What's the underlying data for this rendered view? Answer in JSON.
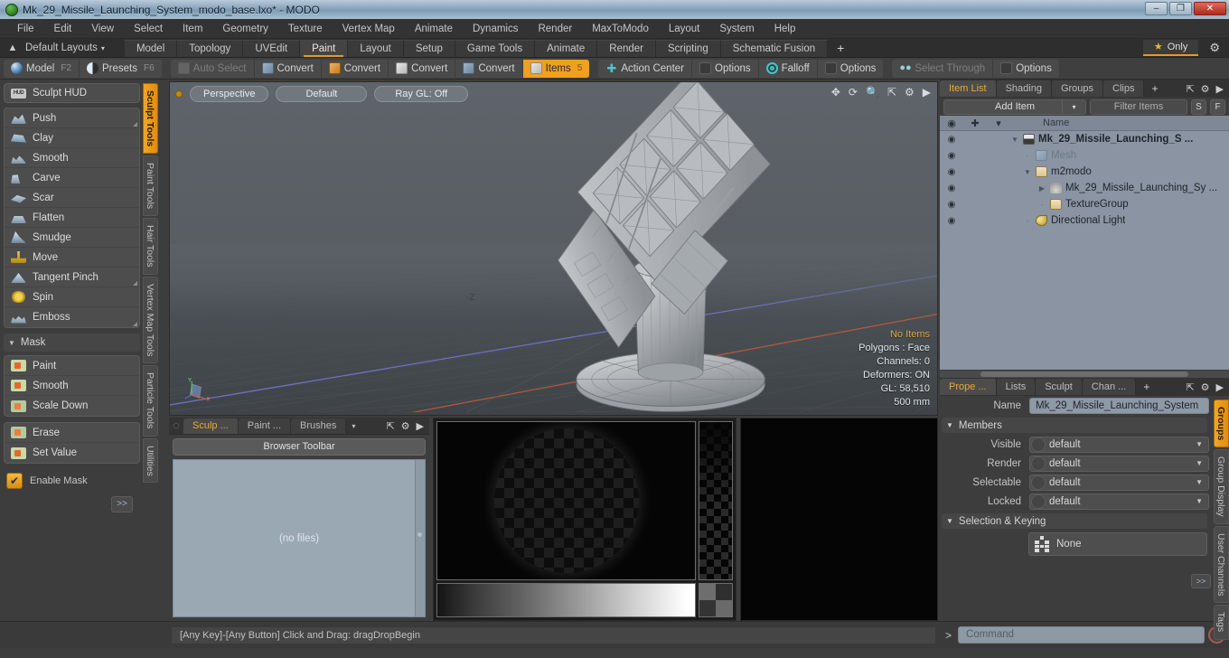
{
  "window": {
    "title": "Mk_29_Missile_Launching_System_modo_base.lxo* - MODO",
    "app_icon": "modo-logo-icon",
    "minimize": "–",
    "maximize": "❐",
    "close": "✕"
  },
  "menubar": {
    "items": [
      "File",
      "Edit",
      "View",
      "Select",
      "Item",
      "Geometry",
      "Texture",
      "Vertex Map",
      "Animate",
      "Dynamics",
      "Render",
      "MaxToModo",
      "Layout",
      "System",
      "Help"
    ]
  },
  "layoutbar": {
    "home_icon": "home-icon",
    "layouts_label": "Default Layouts",
    "caret": "▾",
    "tabs": [
      {
        "label": "Model",
        "active": false
      },
      {
        "label": "Topology",
        "active": false
      },
      {
        "label": "UVEdit",
        "active": false
      },
      {
        "label": "Paint",
        "active": true
      },
      {
        "label": "Layout",
        "active": false
      },
      {
        "label": "Setup",
        "active": false
      },
      {
        "label": "Game Tools",
        "active": false
      },
      {
        "label": "Animate",
        "active": false
      },
      {
        "label": "Render",
        "active": false
      },
      {
        "label": "Scripting",
        "active": false
      },
      {
        "label": "Schematic Fusion",
        "active": false
      }
    ],
    "add_tab": "+",
    "only_label": "Only",
    "star": "★",
    "gear": "⚙"
  },
  "toolbar": {
    "mode_group": [
      {
        "label": "Model",
        "fkey": "F2",
        "icon": "sphere-icon"
      },
      {
        "label": "Presets",
        "fkey": "F6",
        "icon": "half-sphere-icon"
      }
    ],
    "convert_group": [
      {
        "label": "Auto Select",
        "icon": "cube-dim-icon",
        "dim": true
      },
      {
        "label": "Convert",
        "icon": "cube-blue-icon",
        "dim": false
      },
      {
        "label": "Convert",
        "icon": "cube-orange-icon",
        "dim": false
      },
      {
        "label": "Convert",
        "icon": "cube-white-icon",
        "dim": false
      },
      {
        "label": "Convert",
        "icon": "cube-grey-icon",
        "dim": false
      },
      {
        "label": "Items",
        "icon": "cube-items-icon",
        "dim": false,
        "highlight": true,
        "badge": "5"
      }
    ],
    "action_group": [
      {
        "label": "Action Center",
        "icon": "crosshair-icon"
      },
      {
        "label": "Options",
        "icon": "checkbox-icon"
      },
      {
        "label": "Falloff",
        "icon": "target-icon"
      },
      {
        "label": "Options",
        "icon": "checkbox-icon"
      }
    ],
    "select_group": [
      {
        "label": "Select Through",
        "icon": "people-icon",
        "dim": true
      },
      {
        "label": "Options",
        "icon": "checkbox-icon",
        "dim": false
      }
    ]
  },
  "left_panel": {
    "hud": {
      "label": "Sculpt HUD",
      "icon": "hud-icon"
    },
    "sculpt_tools": [
      {
        "label": "Push",
        "icon": "push-icon",
        "corner": true
      },
      {
        "label": "Clay",
        "icon": "clay-icon",
        "corner": false
      },
      {
        "label": "Smooth",
        "icon": "smooth-icon",
        "corner": false
      },
      {
        "label": "Carve",
        "icon": "carve-icon",
        "corner": false
      },
      {
        "label": "Scar",
        "icon": "scar-icon",
        "corner": false
      },
      {
        "label": "Flatten",
        "icon": "flatten-icon",
        "corner": false
      },
      {
        "label": "Smudge",
        "icon": "smudge-icon",
        "corner": false
      },
      {
        "label": "Move",
        "icon": "move-icon",
        "corner": false
      },
      {
        "label": "Tangent Pinch",
        "icon": "pinch-icon",
        "corner": true
      },
      {
        "label": "Spin",
        "icon": "spin-icon",
        "corner": false
      },
      {
        "label": "Emboss",
        "icon": "emboss-icon",
        "corner": true
      }
    ],
    "mask_section": {
      "label": "Mask",
      "triangle": "▼"
    },
    "mask_tools_a": [
      {
        "label": "Paint",
        "icon": "mask-paint-icon"
      },
      {
        "label": "Smooth",
        "icon": "mask-smooth-icon"
      },
      {
        "label": "Scale Down",
        "icon": "mask-scale-icon"
      }
    ],
    "mask_tools_b": [
      {
        "label": "Erase",
        "icon": "mask-erase-icon"
      },
      {
        "label": "Set Value",
        "icon": "mask-setvalue-icon"
      }
    ],
    "enable_mask": {
      "label": "Enable Mask",
      "checked": true,
      "check": "✔"
    },
    "expand_btn": ">>",
    "vtabs": [
      {
        "label": "Sculpt Tools",
        "active": true
      },
      {
        "label": "Paint Tools",
        "active": false
      },
      {
        "label": "Hair Tools",
        "active": false
      },
      {
        "label": "Vertex Map Tools",
        "active": false
      },
      {
        "label": "Particle Tools",
        "active": false
      },
      {
        "label": "Utilities",
        "active": false
      }
    ]
  },
  "viewport": {
    "pills": [
      "Perspective",
      "Default",
      "Ray GL: Off"
    ],
    "tool_icons": [
      "move-icon",
      "rotate-icon",
      "zoom-icon",
      "fit-icon",
      "gear-icon",
      "play-icon"
    ],
    "axis_label": "-Z",
    "stats": {
      "no_items": "No Items",
      "polygons": "Polygons : Face",
      "channels": "Channels: 0",
      "deformers": "Deformers: ON",
      "gl": "GL: 58,510",
      "scale": "500 mm"
    }
  },
  "browser_panel": {
    "tabs": [
      {
        "label": "Sculp ...",
        "active": true
      },
      {
        "label": "Paint ...",
        "active": false
      },
      {
        "label": "Brushes",
        "active": false
      }
    ],
    "tab_caret": "▾",
    "controls": [
      "expand-icon",
      "gear-icon",
      "play-icon"
    ],
    "toolbar_label": "Browser Toolbar",
    "empty_text": "(no files)"
  },
  "brush_preview": {
    "name": "brush-alpha-preview",
    "swatches": [
      "#6e6e6e",
      "#2f2f2f",
      "#343434",
      "#6a6a6a"
    ]
  },
  "right_panel": {
    "top_tabs": [
      {
        "label": "Item List",
        "active": true
      },
      {
        "label": "Shading",
        "active": false
      },
      {
        "label": "Groups",
        "active": false
      },
      {
        "label": "Clips",
        "active": false
      }
    ],
    "top_tabs_plus": "+",
    "top_controls": [
      "expand-icon",
      "gear-icon",
      "play-icon"
    ],
    "add_item": "Add Item",
    "add_item_caret": "▾",
    "filter_placeholder": "Filter Items",
    "s_btn": "S",
    "f_btn": "F",
    "list_headers": {
      "eye": "◉",
      "plus": "✚",
      "axis": "axis-icon",
      "name": "Name"
    },
    "items": [
      {
        "label": "Mk_29_Missile_Launching_S ...",
        "indent": 0,
        "twisty": "▼",
        "icon": "scene-icon",
        "bold": true,
        "dim": false,
        "eye": "◉"
      },
      {
        "label": "Mesh",
        "indent": 1,
        "twisty": "·",
        "icon": "mesh-icon",
        "bold": false,
        "dim": true,
        "eye": "◉"
      },
      {
        "label": "m2modo",
        "indent": 1,
        "twisty": "▼",
        "icon": "folder-icon",
        "bold": false,
        "dim": false,
        "eye": "◉"
      },
      {
        "label": "Mk_29_Missile_Launching_Sy ...",
        "indent": 2,
        "twisty": "▶",
        "icon": "locator-icon",
        "bold": false,
        "dim": false,
        "eye": "◉"
      },
      {
        "label": "TextureGroup",
        "indent": 2,
        "twisty": "·",
        "icon": "folder-icon",
        "bold": false,
        "dim": false,
        "eye": "◉"
      },
      {
        "label": "Directional Light",
        "indent": 1,
        "twisty": "·",
        "icon": "light-icon",
        "bold": false,
        "dim": false,
        "eye": "◉"
      }
    ],
    "prop_tabs": [
      {
        "label": "Prope ...",
        "active": true
      },
      {
        "label": "Lists",
        "active": false
      },
      {
        "label": "Sculpt",
        "active": false
      },
      {
        "label": "Chan ...",
        "active": false
      }
    ],
    "prop_tabs_plus": "+",
    "name_label": "Name",
    "name_value": "Mk_29_Missile_Launching_System",
    "members_section": {
      "label": "Members",
      "triangle": "▼"
    },
    "member_rows": [
      {
        "label": "Visible",
        "value": "default"
      },
      {
        "label": "Render",
        "value": "default"
      },
      {
        "label": "Selectable",
        "value": "default"
      },
      {
        "label": "Locked",
        "value": "default"
      }
    ],
    "selection_section": {
      "label": "Selection & Keying",
      "triangle": "▼"
    },
    "keying_value": "None",
    "keying_icon": "keying-dots-icon",
    "expand_btn": ">>",
    "vtabs": [
      {
        "label": "Groups",
        "active": true
      },
      {
        "label": "Group Display",
        "active": false
      },
      {
        "label": "User Channels",
        "active": false
      },
      {
        "label": "Tags",
        "active": false
      }
    ]
  },
  "statusbar": {
    "message": "[Any Key]-[Any Button] Click and Drag:   dragDropBegin",
    "command_prompt": ">",
    "command_placeholder": "Command",
    "record_icon": "record-icon"
  },
  "colors": {
    "accent_orange": "#e9a93c",
    "highlight_orange": "#f0a020",
    "teal": "#3cc9c9",
    "panel_bg": "#3d3d3d",
    "list_bg": "#8a94a2"
  }
}
